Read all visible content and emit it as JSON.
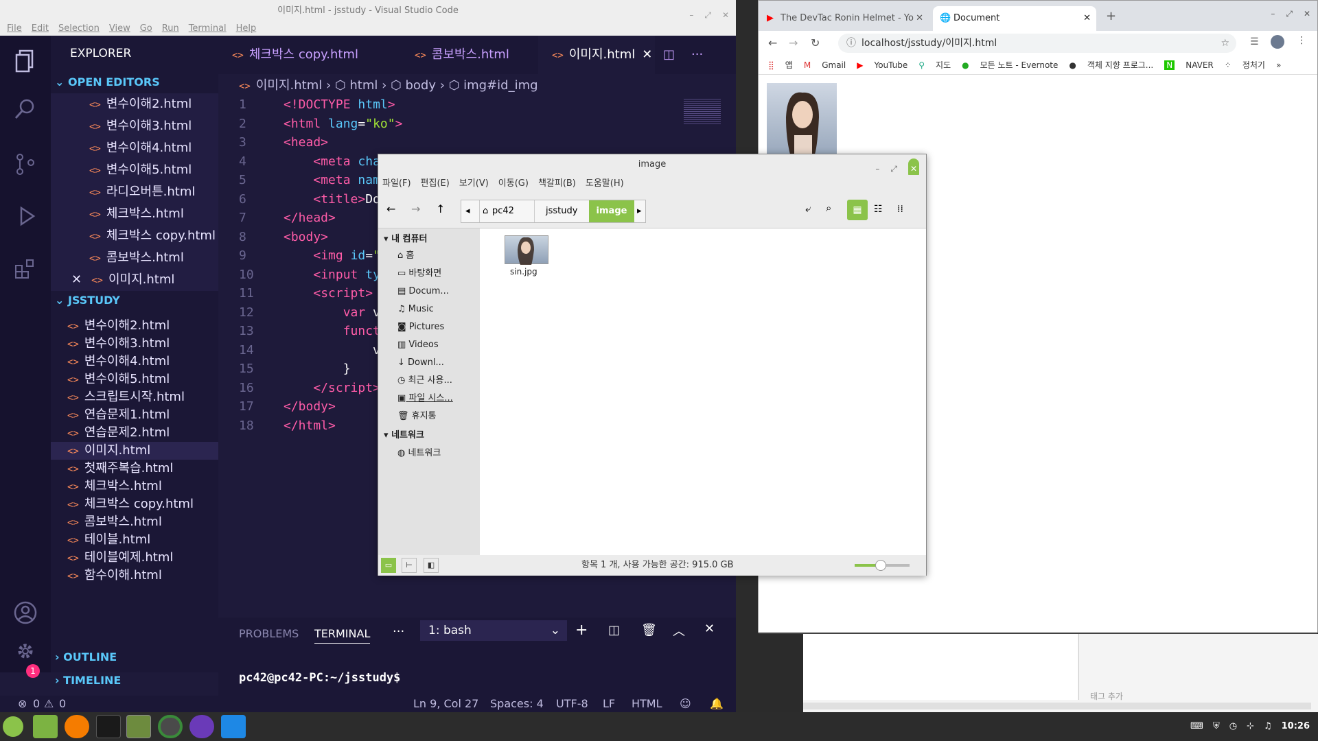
{
  "vscode": {
    "title": "이미지.html - jsstudy - Visual Studio Code",
    "menu": [
      "File",
      "Edit",
      "Selection",
      "View",
      "Go",
      "Run",
      "Terminal",
      "Help"
    ],
    "explorer_label": "EXPLORER",
    "open_editors_label": "OPEN EDITORS",
    "open_editors": [
      "변수이해2.html",
      "변수이해3.html",
      "변수이해4.html",
      "변수이해5.html",
      "라디오버튼.html",
      "체크박스.html",
      "체크박스 copy.html",
      "콤보박스.html",
      "이미지.html"
    ],
    "project_label": "JSSTUDY",
    "project_files": [
      "변수이해2.html",
      "변수이해3.html",
      "변수이해4.html",
      "변수이해5.html",
      "스크립트시작.html",
      "연습문제1.html",
      "연습문제2.html",
      "이미지.html",
      "첫째주복습.html",
      "체크박스.html",
      "체크박스 copy.html",
      "콤보박스.html",
      "테이블.html",
      "테이블예제.html",
      "함수이해.html"
    ],
    "outline_label": "OUTLINE",
    "timeline_label": "TIMELINE",
    "badge_count": "1",
    "tabs": [
      "체크박스 copy.html",
      "콤보박스.html",
      "이미지.html"
    ],
    "breadcrumb": [
      "이미지.html",
      "html",
      "body",
      "img#id_img"
    ],
    "line_numbers": [
      "1",
      "2",
      "3",
      "4",
      "5",
      "6",
      "7",
      "8",
      "9",
      "10",
      "11",
      "12",
      "13",
      "14",
      "15",
      "16",
      "17",
      "18"
    ],
    "panel_tabs": [
      "PROBLEMS",
      "TERMINAL"
    ],
    "terminal_select": "1: bash",
    "terminal_prompt": "pc42@pc42-PC:~/jsstudy$",
    "status": {
      "errors": "0",
      "warnings": "0",
      "position": "Ln 9, Col 27",
      "spaces": "Spaces: 4",
      "encoding": "UTF-8",
      "eol": "LF",
      "language": "HTML"
    }
  },
  "chrome": {
    "tabs": [
      "The DevTac Ronin Helmet - Yo",
      "Document"
    ],
    "url": "localhost/jsstudy/이미지.html",
    "bookmarks": [
      "앱",
      "Gmail",
      "YouTube",
      "지도",
      "모든 노트 - Evernote",
      "객체 지향 프로그...",
      "NAVER",
      "정처기"
    ],
    "tag_add": "태그 추가"
  },
  "filemanager": {
    "title": "image",
    "menu": [
      "파일(F)",
      "편집(E)",
      "보기(V)",
      "이동(G)",
      "책갈피(B)",
      "도움말(H)"
    ],
    "path": [
      "pc42",
      "jsstudy",
      "image"
    ],
    "sections": [
      "내 컴퓨터",
      "네트워크"
    ],
    "places": [
      "홈",
      "바탕화면",
      "Docum...",
      "Music",
      "Pictures",
      "Videos",
      "Downl...",
      "최근 사용...",
      "파일 시스...",
      "휴지통"
    ],
    "network_items": [
      "네트워크"
    ],
    "file_name": "sin.jpg",
    "status": "항목 1 개, 사용 가능한 공간: 915.0 GB"
  },
  "taskbar": {
    "time": "10:26"
  }
}
